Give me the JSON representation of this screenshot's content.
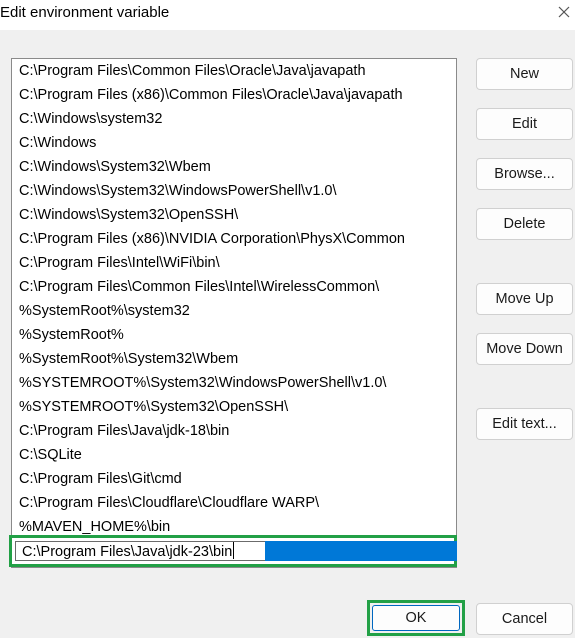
{
  "window": {
    "title": "Edit environment variable"
  },
  "paths": [
    "C:\\Program Files\\Common Files\\Oracle\\Java\\javapath",
    "C:\\Program Files (x86)\\Common Files\\Oracle\\Java\\javapath",
    "C:\\Windows\\system32",
    "C:\\Windows",
    "C:\\Windows\\System32\\Wbem",
    "C:\\Windows\\System32\\WindowsPowerShell\\v1.0\\",
    "C:\\Windows\\System32\\OpenSSH\\",
    "C:\\Program Files (x86)\\NVIDIA Corporation\\PhysX\\Common",
    "C:\\Program Files\\Intel\\WiFi\\bin\\",
    "C:\\Program Files\\Common Files\\Intel\\WirelessCommon\\",
    "%SystemRoot%\\system32",
    "%SystemRoot%",
    "%SystemRoot%\\System32\\Wbem",
    "%SYSTEMROOT%\\System32\\WindowsPowerShell\\v1.0\\",
    "%SYSTEMROOT%\\System32\\OpenSSH\\",
    "C:\\Program Files\\Java\\jdk-18\\bin",
    "C:\\SQLite",
    "C:\\Program Files\\Git\\cmd",
    "C:\\Program Files\\Cloudflare\\Cloudflare WARP\\",
    "%MAVEN_HOME%\\bin"
  ],
  "editing": {
    "value": "C:\\Program Files\\Java\\jdk-23\\bin"
  },
  "buttons": {
    "new": "New",
    "edit": "Edit",
    "browse": "Browse...",
    "delete": "Delete",
    "move_up": "Move Up",
    "move_down": "Move Down",
    "edit_text": "Edit text...",
    "ok": "OK",
    "cancel": "Cancel"
  },
  "colors": {
    "highlight_outline": "#22a046",
    "selection": "#0078d7",
    "dialog_background": "#f0f0f0"
  }
}
